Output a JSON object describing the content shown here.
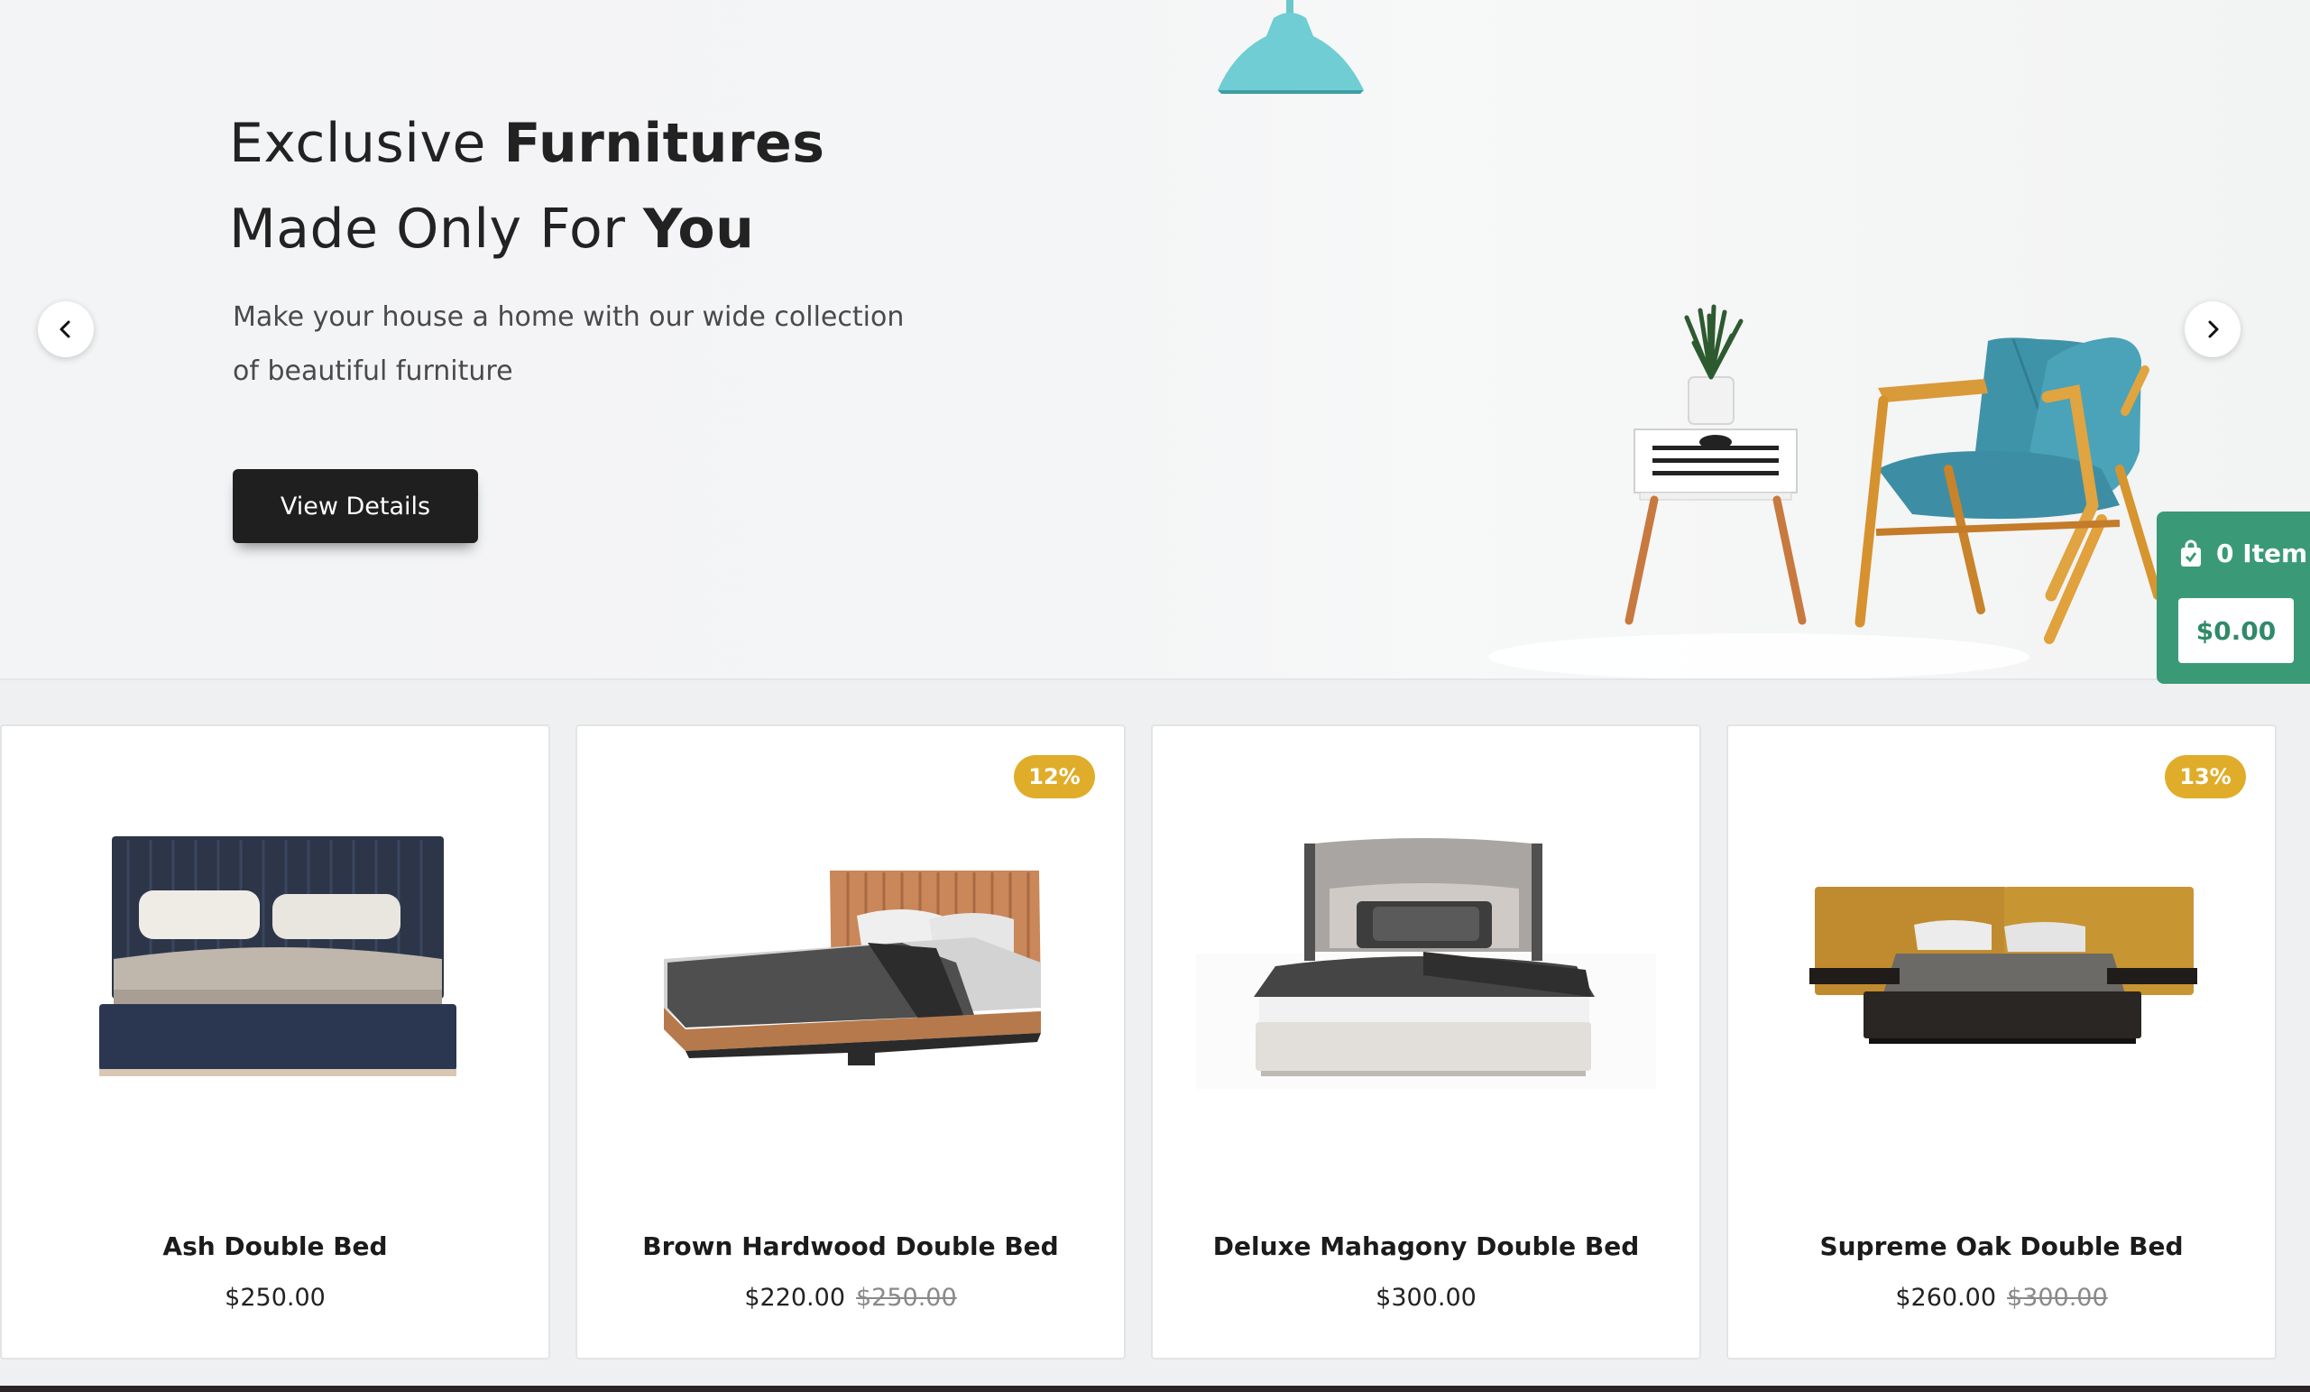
{
  "hero": {
    "title_line1_regular": "Exclusive ",
    "title_line1_bold": "Furnitures",
    "title_line2_regular": "Made Only For ",
    "title_line2_bold": "You",
    "subtitle_line1": "Make your house a home with our wide collection",
    "subtitle_line2": "of beautiful furniture",
    "button_label": "View Details",
    "prev_icon": "chevron-left-icon",
    "next_icon": "chevron-right-icon"
  },
  "cart": {
    "icon": "shopping-bag-icon",
    "count_label": "0 Item",
    "total": "$0.00",
    "accent_color": "#3a9a77"
  },
  "products": [
    {
      "name": "Ash Double Bed",
      "price": "$250.00",
      "old_price": "",
      "badge": ""
    },
    {
      "name": "Brown Hardwood Double Bed",
      "price": "$220.00",
      "old_price": "$250.00",
      "badge": "12%"
    },
    {
      "name": "Deluxe Mahagony Double Bed",
      "price": "$300.00",
      "old_price": "",
      "badge": ""
    },
    {
      "name": "Supreme Oak Double Bed",
      "price": "$260.00",
      "old_price": "$300.00",
      "badge": "13%"
    }
  ],
  "colors": {
    "badge": "#e0ad2b",
    "button_dark": "#1f1f1f"
  }
}
